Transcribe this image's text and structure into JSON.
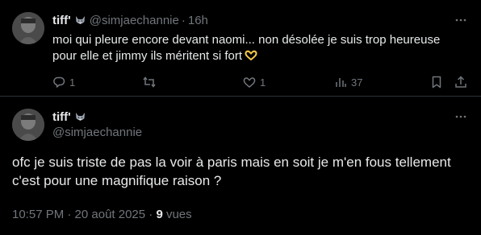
{
  "reply_tweet": {
    "author_name": "tiff'",
    "author_badge_icon": "wolf-emoji",
    "handle": "@simjaechannie",
    "separator": "·",
    "time": "16h",
    "text": "moi qui pleure encore devant naomi... non désolée je suis trop heureuse pour elle et jimmy ils méritent si fort",
    "trailing_emoji": "heart-hands-emoji",
    "actions": {
      "reply_count": "1",
      "retweet_count": "",
      "like_count": "1",
      "views_count": "37"
    }
  },
  "main_tweet": {
    "author_name": "tiff'",
    "author_badge_icon": "wolf-emoji",
    "handle": "@simjaechannie",
    "text": "ofc je suis triste de pas la voir à paris mais en soit je m'en fous tellement c'est pour une magnifique raison ?",
    "timestamp": "10:57 PM · 20 août 2025 · ",
    "views_number": "9",
    "views_label": " vues"
  },
  "colors": {
    "background": "#000000",
    "text_primary": "#e7e9ea",
    "text_secondary": "#71767b",
    "divider": "#2f3336",
    "heart_emoji": "#f7c948"
  }
}
